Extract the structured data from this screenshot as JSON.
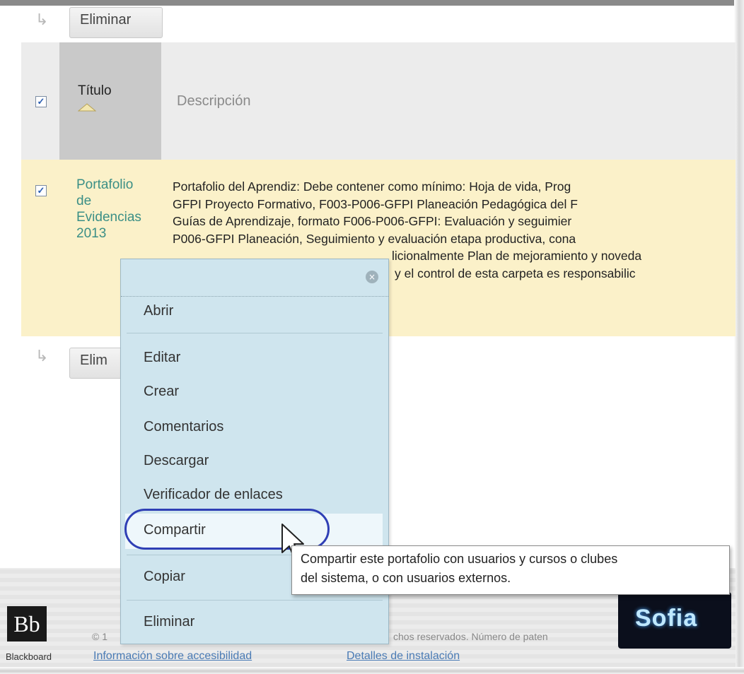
{
  "actions": {
    "delete_top": "Eliminar",
    "delete_bottom": "Elim"
  },
  "table": {
    "header": {
      "title": "Título",
      "description": "Descripción"
    },
    "row": {
      "title_lines": [
        "Portafolio",
        "de",
        "Evidencias",
        "2013"
      ],
      "description_lines": [
        "Portafolio del Aprendiz: Debe contener como mínimo: Hoja de vida, Prog",
        "GFPI Proyecto Formativo, F003-P006-GFPI Planeación Pedagógica del F",
        "Guías de Aprendizaje, formato F006-P006-GFPI: Evaluación y seguimier",
        "P006-GFPI Planeación, Seguimiento y evaluación etapa productiva, cona",
        "licionalmente Plan de mejoramiento y noveda",
        "y el control de esta carpeta es responsabilic"
      ]
    }
  },
  "context_menu": {
    "items": [
      "Abrir",
      "Editar",
      "Crear",
      "Comentarios",
      "Descargar",
      "Verificador de enlaces",
      "Compartir",
      "Copiar",
      "Eliminar"
    ],
    "close_icon": "×"
  },
  "tooltip": {
    "lines": [
      "Compartir este portafolio con usuarios y cursos o clubes",
      "del sistema, o con usuarios externos."
    ]
  },
  "footer": {
    "logo_text": "Bb",
    "logo_caption": "Blackboard",
    "copyright_fragment_left": "© 1",
    "copyright_fragment_right": "chos reservados. Número de paten",
    "link_accessibility": "Información sobre accesibilidad",
    "link_installation": "Detalles de instalación",
    "brand_right": "Sofia"
  },
  "colors": {
    "title_link": "#3b8f86",
    "menu_bg": "#cfe5ee",
    "ring": "#2f3fb5",
    "row_highlight": "#fbf1c9"
  }
}
